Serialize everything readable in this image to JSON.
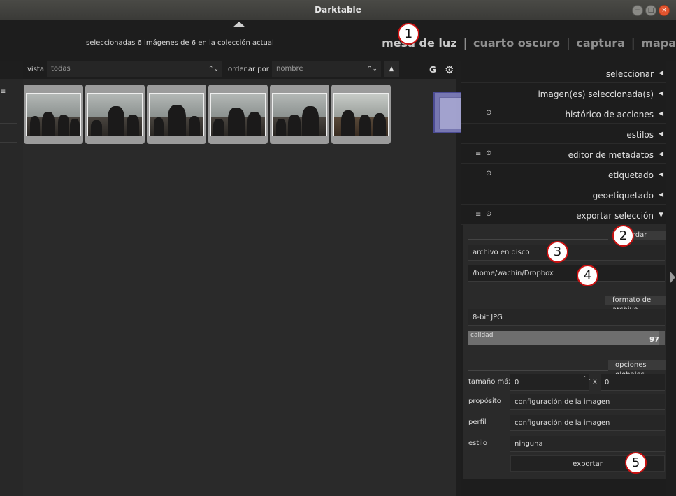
{
  "window": {
    "title": "Darktable"
  },
  "header": {
    "selection_info": "seleccionadas 6 imágenes de 6 en la colección actual",
    "views": [
      "mesa de luz",
      "cuarto oscuro",
      "captura",
      "mapa"
    ],
    "active_view": "mesa de luz",
    "separator": "|"
  },
  "filterbar": {
    "view_label": "vista",
    "view_value": "todas",
    "sort_label": "ordenar por",
    "sort_value": "nombre",
    "sort_direction": "▲",
    "group_label": "G",
    "settings_icon": "gear-icon"
  },
  "leftpanel": {
    "menu_glyph": "≡"
  },
  "thumbnails": {
    "count": 6
  },
  "modules": [
    {
      "name": "seleccionar",
      "expanded": false,
      "icons": []
    },
    {
      "name": "imagen(es) seleccionada(s)",
      "expanded": false,
      "icons": []
    },
    {
      "name": "histórico de acciones",
      "expanded": false,
      "icons": [
        "reset-icon"
      ]
    },
    {
      "name": "estilos",
      "expanded": false,
      "icons": []
    },
    {
      "name": "editor de metadatos",
      "expanded": false,
      "icons": [
        "presets-icon",
        "reset-icon"
      ]
    },
    {
      "name": "etiquetado",
      "expanded": false,
      "icons": [
        "reset-icon"
      ]
    },
    {
      "name": "geoetiquetado",
      "expanded": false,
      "icons": []
    },
    {
      "name": "exportar selección",
      "expanded": true,
      "icons": [
        "presets-icon",
        "reset-icon"
      ]
    }
  ],
  "export": {
    "storage_section": "guardar",
    "storage_target": "archivo en disco",
    "storage_path": "/home/wachin/Dropbox",
    "format_section": "formato de archivo",
    "format": "8-bit JPG",
    "quality_label": "calidad",
    "quality_value": "97",
    "quality_fraction": 0.97,
    "global_section": "opciones globales",
    "max_size_label": "tamaño máx",
    "max_width": "0",
    "size_x": "x",
    "max_height": "0",
    "intent_label": "propósito",
    "intent_value": "configuración de la imagen",
    "profile_label": "perfil",
    "profile_value": "configuración de la imagen",
    "style_label": "estilo",
    "style_value": "ninguna",
    "export_button": "exportar"
  },
  "callouts": [
    "1",
    "2",
    "3",
    "4",
    "5"
  ],
  "icons": {
    "minimize": "−",
    "maximize": "□",
    "close": "×",
    "reset": "⊙",
    "presets": "≡",
    "collapsed_arrow": "◀",
    "expanded_arrow": "▼",
    "combo_arrow": "⌃⌄",
    "spin": "⌃⌄",
    "gear": "⚙"
  }
}
